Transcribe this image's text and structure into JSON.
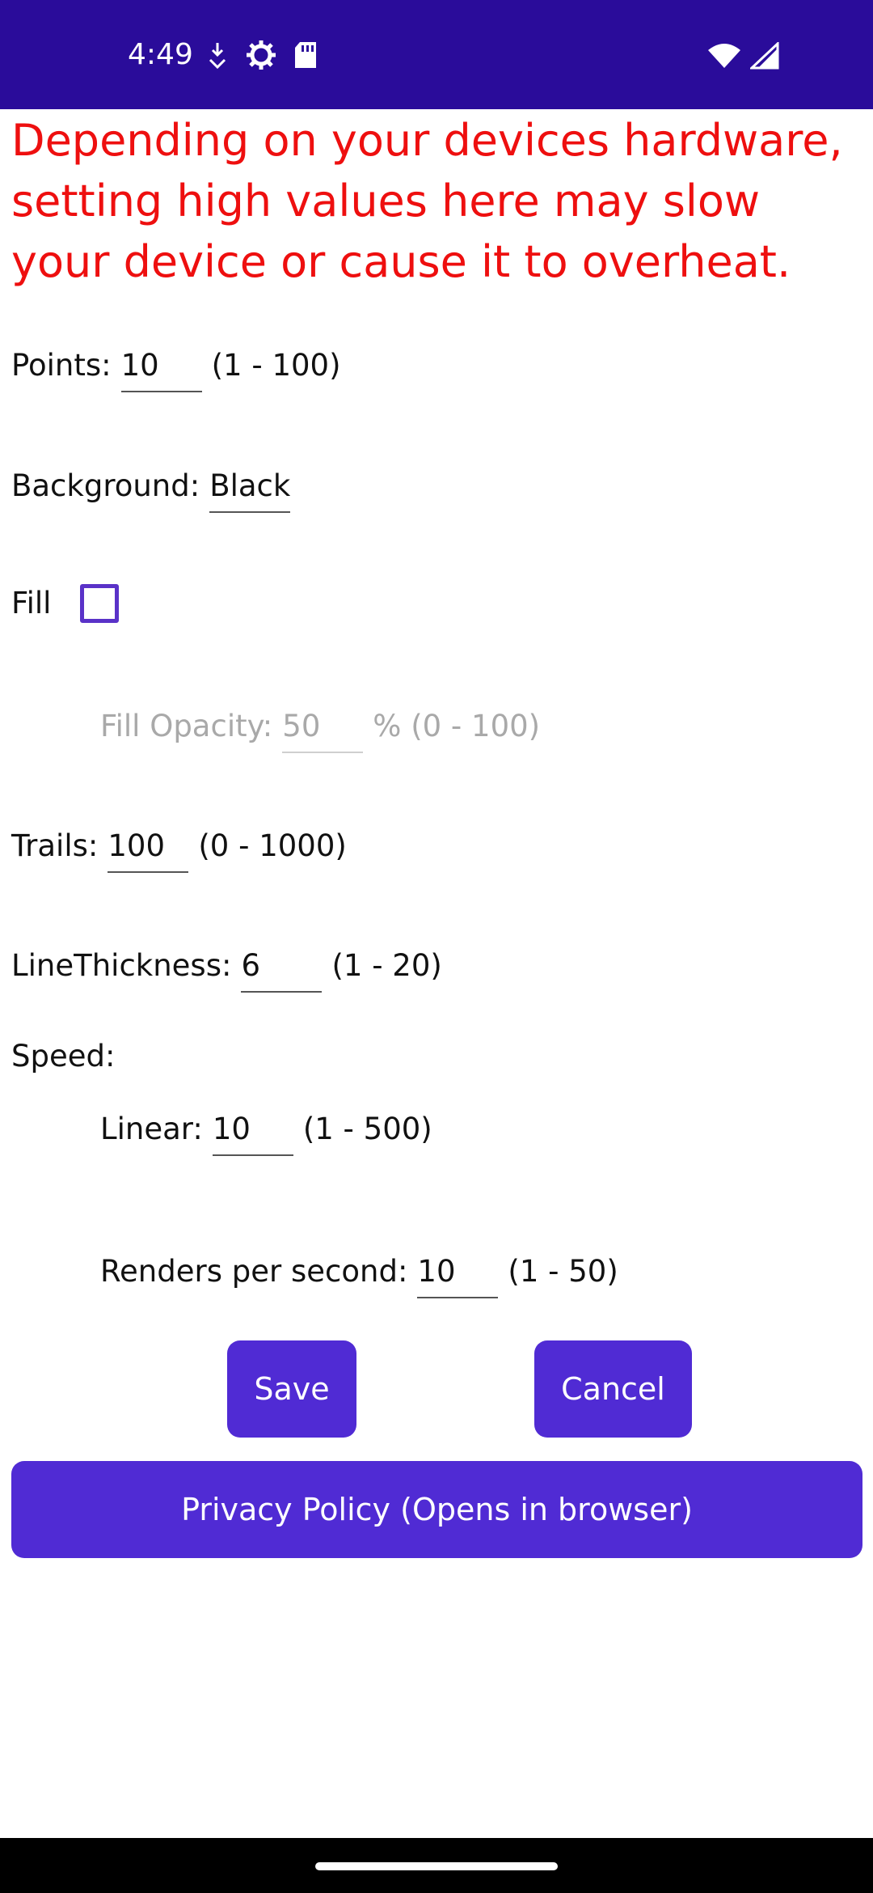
{
  "status_bar": {
    "time": "4:49",
    "icons_left": [
      "download-arrow-icon",
      "gear-icon",
      "sd-card-icon"
    ],
    "icons_right": [
      "wifi-icon",
      "cell-signal-icon"
    ]
  },
  "warning": "Depending on your devices hardware, setting high values here may slow your device or cause it to overheat.",
  "fields": {
    "points": {
      "label": "Points:",
      "value": "10",
      "range": "(1 - 100)"
    },
    "background": {
      "label": "Background:",
      "value": "Black"
    },
    "fill": {
      "label": "Fill",
      "checked": false
    },
    "fill_opacity": {
      "label": "Fill Opacity:",
      "value": "50",
      "range": "% (0 - 100)"
    },
    "trails": {
      "label": "Trails:",
      "value": "100",
      "range": "(0 - 1000)"
    },
    "line_thickness": {
      "label": "LineThickness:",
      "value": "6",
      "range": "(1 - 20)"
    },
    "speed": {
      "label": "Speed:"
    },
    "linear": {
      "label": "Linear:",
      "value": "10",
      "range": "(1 - 500)"
    },
    "renders": {
      "label": "Renders per second:",
      "value": "10",
      "range": "(1 - 50)"
    }
  },
  "buttons": {
    "save": "Save",
    "cancel": "Cancel",
    "privacy": "Privacy Policy (Opens in browser)"
  },
  "colors": {
    "status_bar": "#2a0c9a",
    "accent": "#502bd4",
    "warning": "#ee0f0f",
    "disabled": "#a9a9a9"
  }
}
